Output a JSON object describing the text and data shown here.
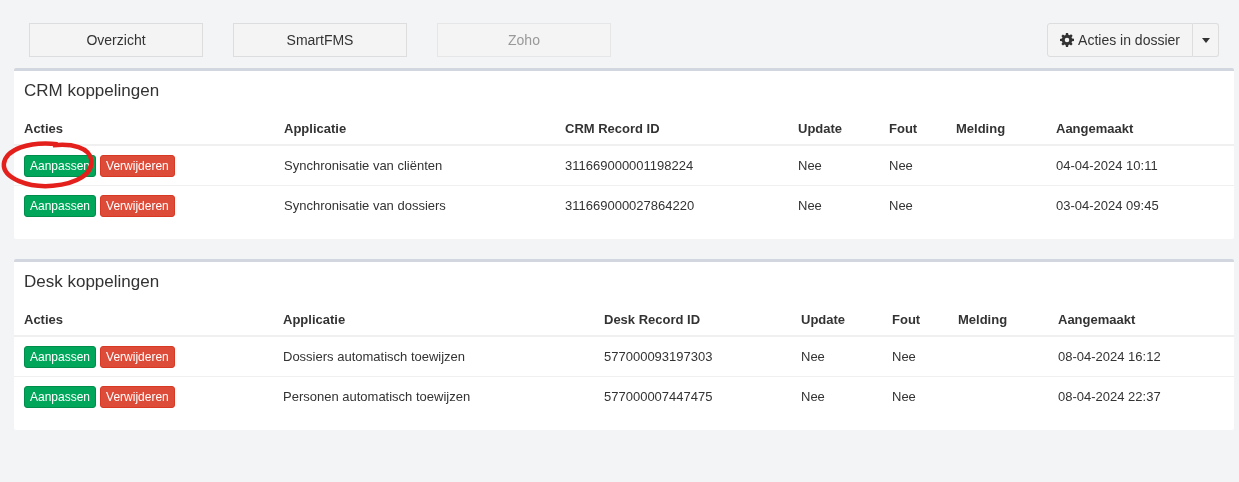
{
  "nav_buttons": [
    {
      "label": "Overzicht",
      "disabled": false
    },
    {
      "label": "SmartFMS",
      "disabled": false
    },
    {
      "label": "Zoho",
      "disabled": true
    }
  ],
  "actions_menu": {
    "label": "Acties in dossier"
  },
  "panels": [
    {
      "title": "CRM koppelingen",
      "columns": [
        "Acties",
        "Applicatie",
        "CRM Record ID",
        "Update",
        "Fout",
        "Melding",
        "Aangemaakt"
      ],
      "rows": [
        {
          "edit": "Aanpassen",
          "delete": "Verwijderen",
          "circled": true,
          "application": "Synchronisatie van cliënten",
          "record_id": "311669000001198224",
          "update": "Nee",
          "error": "Nee",
          "created": "04-04-2024 10:11"
        },
        {
          "edit": "Aanpassen",
          "delete": "Verwijderen",
          "circled": false,
          "application": "Synchronisatie van dossiers",
          "record_id": "311669000027864220",
          "update": "Nee",
          "error": "Nee",
          "created": "03-04-2024 09:45"
        }
      ]
    },
    {
      "title": "Desk koppelingen",
      "columns": [
        "Acties",
        "Applicatie",
        "Desk Record ID",
        "Update",
        "Fout",
        "Melding",
        "Aangemaakt"
      ],
      "rows": [
        {
          "edit": "Aanpassen",
          "delete": "Verwijderen",
          "circled": false,
          "application": "Dossiers automatisch toewijzen",
          "record_id": "577000093197303",
          "update": "Nee",
          "error": "Nee",
          "created": "08-04-2024 16:12"
        },
        {
          "edit": "Aanpassen",
          "delete": "Verwijderen",
          "circled": false,
          "application": "Personen automatisch toewijzen",
          "record_id": "577000007447475",
          "update": "Nee",
          "error": "Nee",
          "created": "08-04-2024 22:37"
        }
      ]
    }
  ]
}
